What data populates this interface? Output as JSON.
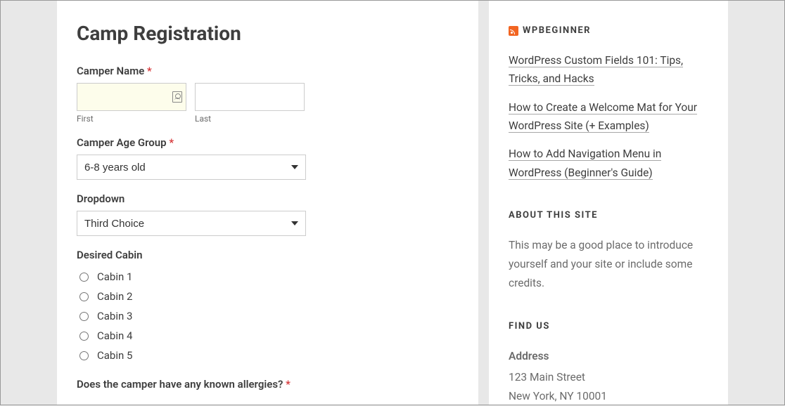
{
  "page": {
    "title": "Camp Registration"
  },
  "form": {
    "camper_name": {
      "label": "Camper Name",
      "required_marker": "*",
      "first_sub": "First",
      "last_sub": "Last",
      "first_value": "",
      "last_value": ""
    },
    "age_group": {
      "label": "Camper Age Group",
      "required_marker": "*",
      "selected": "6-8 years old"
    },
    "dropdown": {
      "label": "Dropdown",
      "selected": "Third Choice"
    },
    "cabin": {
      "label": "Desired Cabin",
      "options": [
        "Cabin 1",
        "Cabin 2",
        "Cabin 3",
        "Cabin 4",
        "Cabin 5"
      ]
    },
    "allergies": {
      "label": "Does the camper have any known allergies?",
      "required_marker": "*"
    }
  },
  "sidebar": {
    "rss": {
      "title": "WPBEGINNER",
      "items": [
        "WordPress Custom Fields 101: Tips, Tricks, and Hacks",
        "How to Create a Welcome Mat for Your WordPress Site (+ Examples)",
        "How to Add Navigation Menu in WordPress (Beginner's Guide)"
      ]
    },
    "about": {
      "title": "ABOUT THIS SITE",
      "text": "This may be a good place to introduce yourself and your site or include some credits."
    },
    "find_us": {
      "title": "FIND US",
      "address_label": "Address",
      "line1": "123 Main Street",
      "line2": "New York, NY 10001"
    }
  }
}
